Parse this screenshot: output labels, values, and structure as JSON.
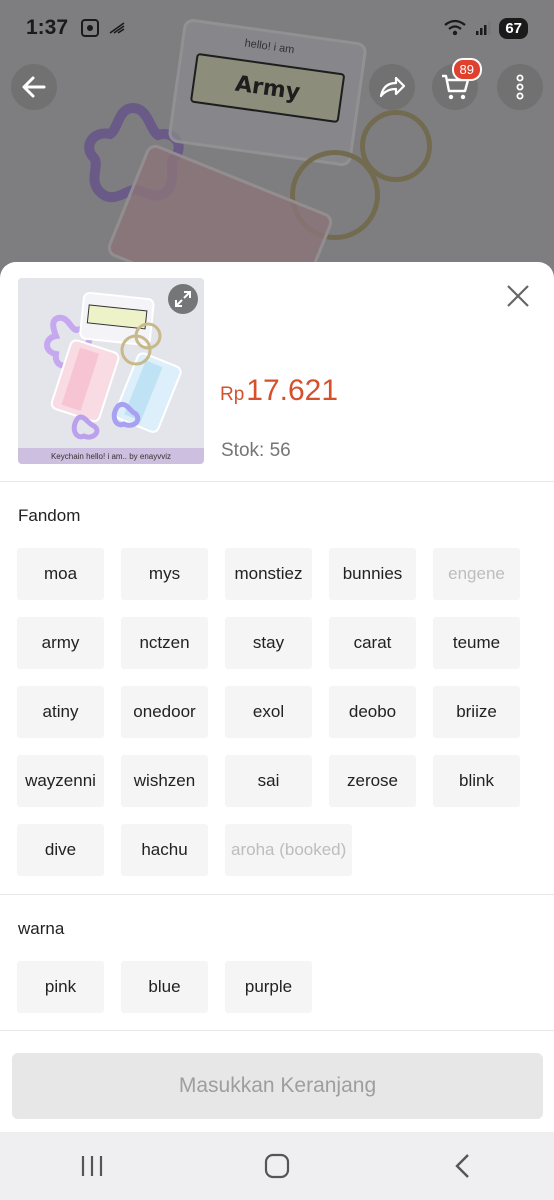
{
  "status_bar": {
    "time": "1:37",
    "battery": "67"
  },
  "header": {
    "cart_count": "89"
  },
  "product_photo": {
    "keychain_text": "Army",
    "keychain_subtext": "hello! i am"
  },
  "product": {
    "thumbnail_caption": "Keychain hello! i am.. by enayvviz",
    "currency": "Rp",
    "price": "17.621",
    "stock": "Stok: 56"
  },
  "variations": [
    {
      "title": "Fandom",
      "options": [
        {
          "label": "moa",
          "disabled": false
        },
        {
          "label": "mys",
          "disabled": false
        },
        {
          "label": "monstiez",
          "disabled": false
        },
        {
          "label": "bunnies",
          "disabled": false
        },
        {
          "label": "engene",
          "disabled": true
        },
        {
          "label": "army",
          "disabled": false
        },
        {
          "label": "nctzen",
          "disabled": false
        },
        {
          "label": "stay",
          "disabled": false
        },
        {
          "label": "carat",
          "disabled": false
        },
        {
          "label": "teume",
          "disabled": false
        },
        {
          "label": "atiny",
          "disabled": false
        },
        {
          "label": "onedoor",
          "disabled": false
        },
        {
          "label": "exol",
          "disabled": false
        },
        {
          "label": "deobo",
          "disabled": false
        },
        {
          "label": "briize",
          "disabled": false
        },
        {
          "label": "wayzenni",
          "disabled": false
        },
        {
          "label": "wishzen",
          "disabled": false
        },
        {
          "label": "sai",
          "disabled": false
        },
        {
          "label": "zerose",
          "disabled": false
        },
        {
          "label": "blink",
          "disabled": false
        },
        {
          "label": "dive",
          "disabled": false
        },
        {
          "label": "hachu",
          "disabled": false
        },
        {
          "label": "aroha (booked)",
          "disabled": true
        }
      ]
    },
    {
      "title": "warna",
      "options": [
        {
          "label": "pink",
          "disabled": false
        },
        {
          "label": "blue",
          "disabled": false
        },
        {
          "label": "purple",
          "disabled": false
        }
      ]
    }
  ],
  "footer": {
    "add_to_cart_label": "Masukkan Keranjang"
  },
  "colors": {
    "price": "#d7502c",
    "badge": "#e0402e",
    "option_bg": "#f5f5f5",
    "disabled_text": "#bdbdbd"
  },
  "icons": [
    "back-arrow-icon",
    "share-icon",
    "cart-icon",
    "more-icon",
    "expand-icon",
    "close-icon",
    "recent-apps-icon",
    "home-icon",
    "nav-back-icon"
  ]
}
